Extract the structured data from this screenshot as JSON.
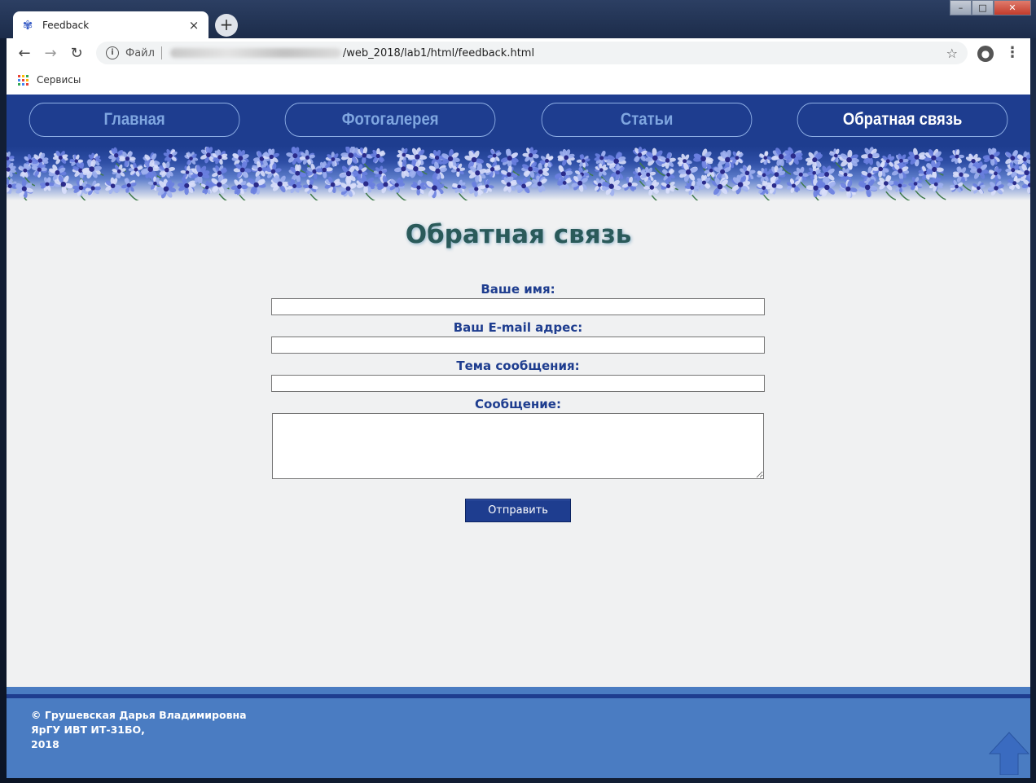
{
  "window": {
    "tab_title": "Feedback",
    "tab_close": "×",
    "new_tab": "+",
    "controls": {
      "minimize": "–",
      "maximize": "□",
      "close": "✕"
    }
  },
  "toolbar": {
    "back": "←",
    "forward": "→",
    "reload": "↻",
    "info": "i",
    "scheme": "Файл",
    "url_visible": "/web_2018/lab1/html/feedback.html",
    "star": "☆",
    "profile": "●",
    "menu": "⋮"
  },
  "bookmarks": {
    "apps_label": "Сервисы",
    "apps_colors": [
      "#ea4335",
      "#fbbc05",
      "#34a853",
      "#4285f4",
      "#ea4335",
      "#fbbc05",
      "#34a853",
      "#4285f4",
      "#ea4335"
    ]
  },
  "nav": {
    "items": [
      {
        "label": "Главная",
        "active": false
      },
      {
        "label": "Фотогалерея",
        "active": false
      },
      {
        "label": "Статьи",
        "active": false
      },
      {
        "label": "Обратная связь",
        "active": true
      }
    ]
  },
  "main": {
    "title": "Обратная связь",
    "form": {
      "name_label": "Ваше имя:",
      "email_label": "Ваш E-mail адрес:",
      "subject_label": "Тема сообщения:",
      "message_label": "Сообщение:",
      "name_value": "",
      "email_value": "",
      "subject_value": "",
      "message_value": "",
      "submit_label": "Отправить"
    }
  },
  "footer": {
    "line1": "© Грушевская Дарья Владимировна",
    "line2": "ЯрГУ ИВТ ИТ-31БО,",
    "line3": "2018",
    "up_icon": "arrow-up-icon"
  },
  "colors": {
    "nav_bg": "#1e3d8f",
    "nav_text": "#7fa6e0",
    "nav_active_text": "#ffffff",
    "page_bg": "#f0f1f2",
    "title_color": "#2a5a5a",
    "label_color": "#1e3d8f",
    "footer_bg": "#4a7cc2"
  }
}
